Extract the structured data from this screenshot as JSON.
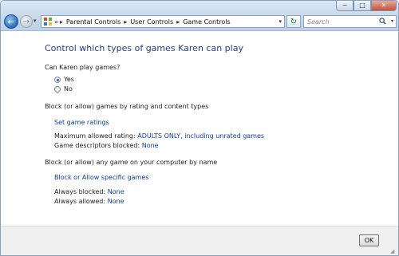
{
  "window": {
    "caption_buttons": {
      "minimize": "−",
      "maximize": "□",
      "close": "✕"
    }
  },
  "navigation": {
    "back_icon": "back-arrow-icon",
    "forward_icon": "forward-arrow-icon",
    "breadcrumb": [
      "Parental Controls",
      "User Controls",
      "Game Controls"
    ],
    "overflow": "«",
    "separator": "▸",
    "search_placeholder": "Search"
  },
  "main": {
    "title": "Control which types of games Karen can play",
    "play_question": "Can Karen play games?",
    "play_options": [
      {
        "label": "Yes",
        "selected": true
      },
      {
        "label": "No",
        "selected": false
      }
    ],
    "rating_section_label": "Block (or allow) games by rating and content types",
    "set_ratings_link": "Set game ratings",
    "max_rating_label": "Maximum allowed rating:",
    "max_rating_value": "ADULTS ONLY, including unrated games",
    "descriptors_label": "Game descriptors blocked:",
    "descriptors_value": "None",
    "specific_section_label": "Block (or allow) any game on your computer by name",
    "specific_link": "Block or Allow specific games",
    "always_blocked_label": "Always blocked:",
    "always_blocked_value": "None",
    "always_allowed_label": "Always allowed:",
    "always_allowed_value": "None"
  },
  "footer": {
    "ok_label": "OK"
  },
  "colors": {
    "title_blue": "#1e3f93",
    "link_blue": "#0a3ea8",
    "chrome_blue": "#c6d8ec"
  }
}
